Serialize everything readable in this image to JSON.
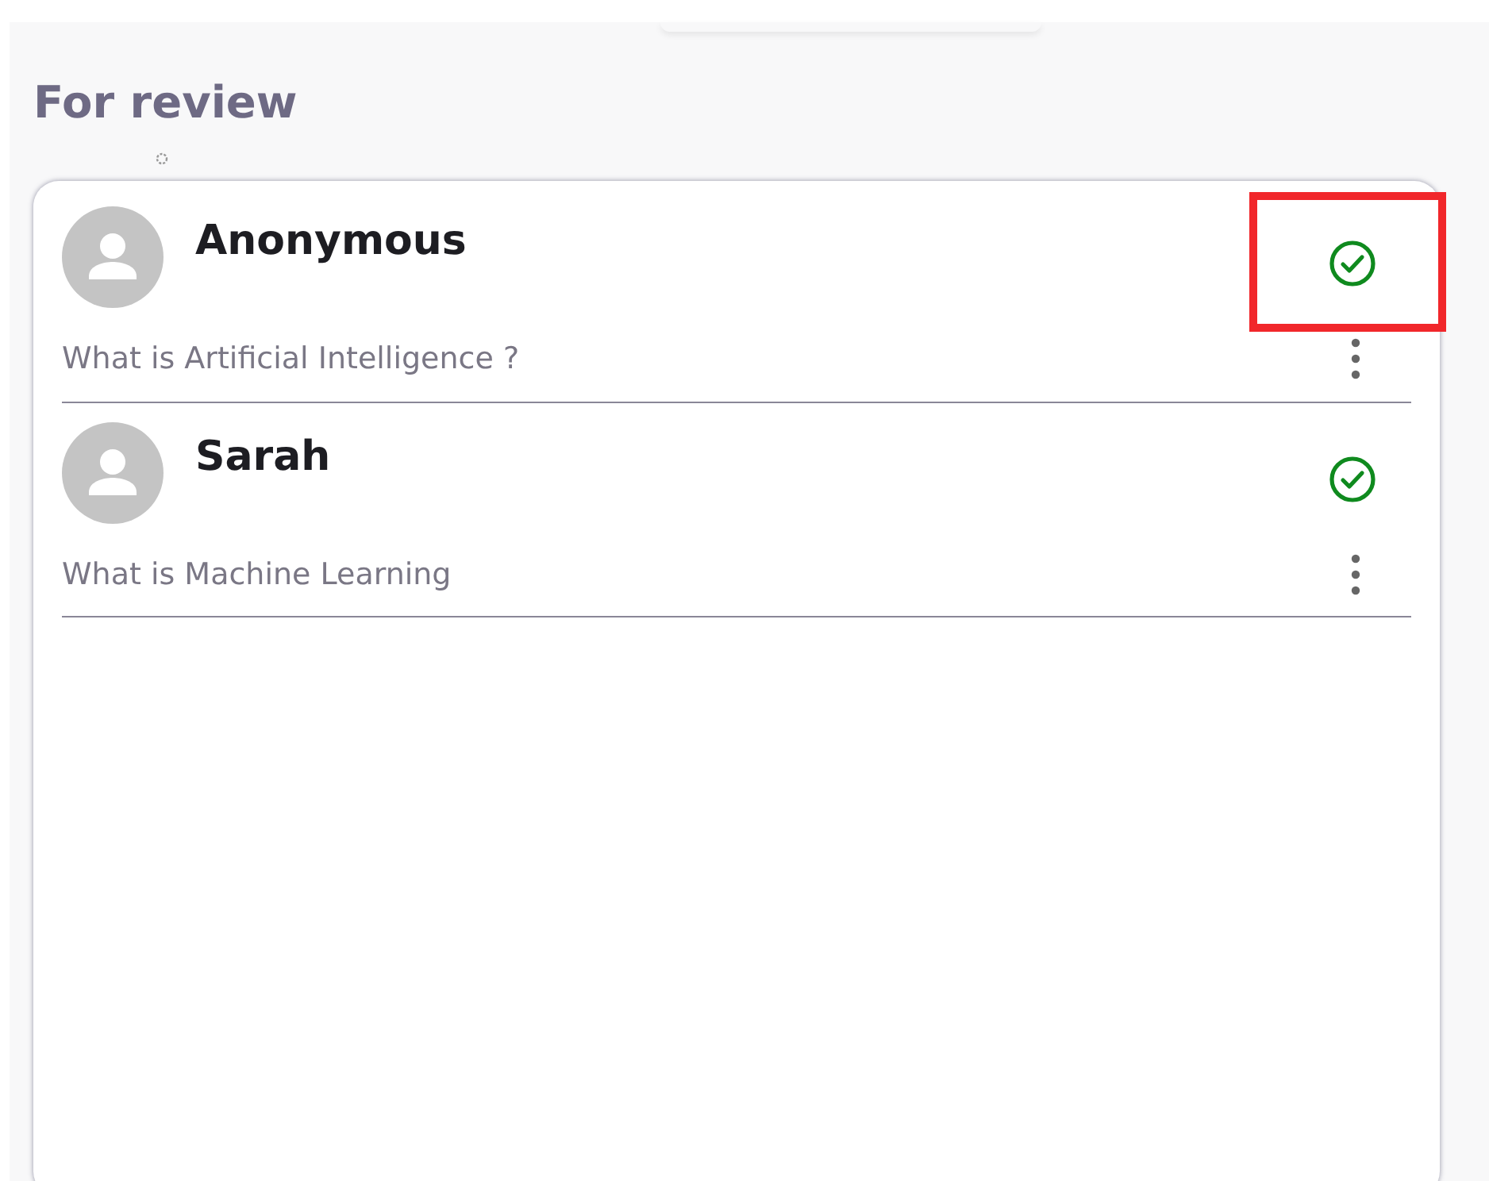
{
  "heading": "For review",
  "items": [
    {
      "name": "Anonymous",
      "question": "What is Artificial Intelligence ?",
      "approved": true,
      "highlighted": true
    },
    {
      "name": "Sarah",
      "question": "What is Machine Learning",
      "approved": true,
      "highlighted": false
    }
  ]
}
